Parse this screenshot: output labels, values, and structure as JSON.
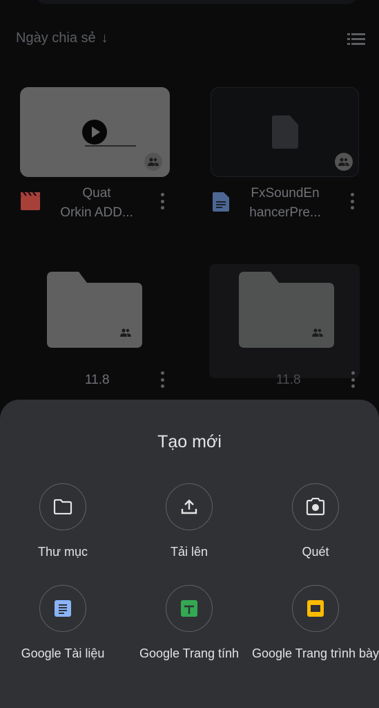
{
  "header": {
    "sort_label": "Ngày chia sẻ",
    "sort_arrow": "↓"
  },
  "files": [
    {
      "name_line1": "Quat",
      "name_line2": "Orkin ADD...",
      "type": "video",
      "shared": true
    },
    {
      "name_line1": "FxSoundEn",
      "name_line2": "hancerPre...",
      "type": "document",
      "shared": true
    },
    {
      "name": "11.8",
      "type": "folder",
      "shared": true
    },
    {
      "name": "11.8",
      "type": "folder",
      "shared": true
    }
  ],
  "sheet": {
    "title": "Tạo mới",
    "actions": [
      {
        "label": "Thư mục",
        "icon": "folder-icon"
      },
      {
        "label": "Tải lên",
        "icon": "upload-icon"
      },
      {
        "label": "Quét",
        "icon": "camera-icon"
      },
      {
        "label": "Google Tài liệu",
        "icon": "google-docs-icon",
        "color": "#8ab4f8"
      },
      {
        "label": "Google Trang tính",
        "icon": "google-sheets-icon",
        "color": "#34a853"
      },
      {
        "label": "Google Trang trình bày",
        "icon": "google-slides-icon",
        "color": "#fbbc04"
      }
    ]
  },
  "colors": {
    "background": "#0b0b0c",
    "sheet": "#303135",
    "video_icon": "#a8403a",
    "doc_icon": "#4d6794"
  }
}
